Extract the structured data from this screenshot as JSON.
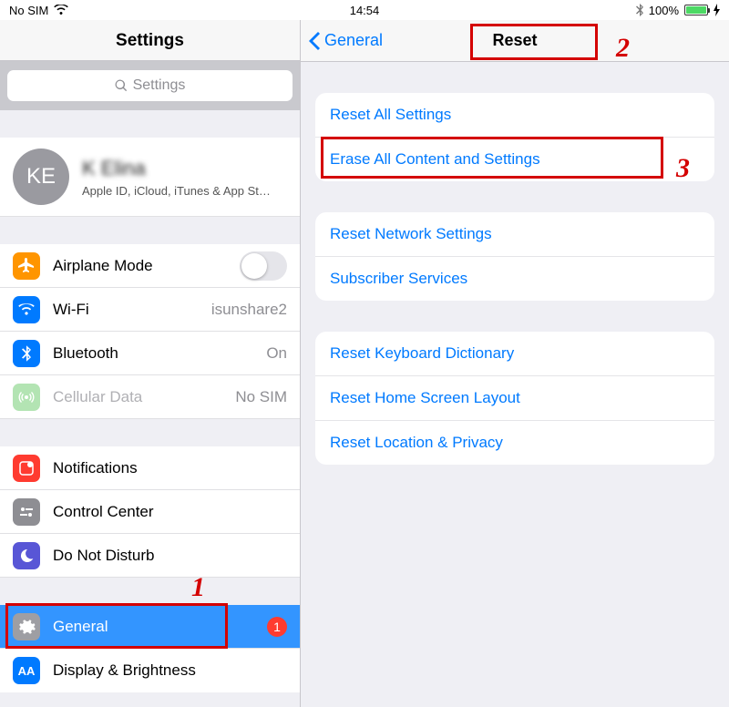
{
  "status": {
    "carrier": "No SIM",
    "time": "14:54",
    "battery": "100%"
  },
  "sidebar": {
    "title": "Settings",
    "search_placeholder": "Settings",
    "account": {
      "initials": "KE",
      "name": "K Elina",
      "sub": "Apple ID, iCloud, iTunes & App St…"
    },
    "g1": [
      {
        "label": "Airplane Mode"
      },
      {
        "label": "Wi-Fi",
        "detail": "isunshare2"
      },
      {
        "label": "Bluetooth",
        "detail": "On"
      },
      {
        "label": "Cellular Data",
        "detail": "No SIM"
      }
    ],
    "g2": [
      {
        "label": "Notifications"
      },
      {
        "label": "Control Center"
      },
      {
        "label": "Do Not Disturb"
      }
    ],
    "g3": [
      {
        "label": "General",
        "badge": "1"
      },
      {
        "label": "Display & Brightness"
      }
    ]
  },
  "detail": {
    "back": "General",
    "title": "Reset",
    "sec1": [
      "Reset All Settings",
      "Erase All Content and Settings"
    ],
    "sec2": [
      "Reset Network Settings",
      "Subscriber Services"
    ],
    "sec3": [
      "Reset Keyboard Dictionary",
      "Reset Home Screen Layout",
      "Reset Location & Privacy"
    ]
  },
  "anno": {
    "n1": "1",
    "n2": "2",
    "n3": "3"
  }
}
